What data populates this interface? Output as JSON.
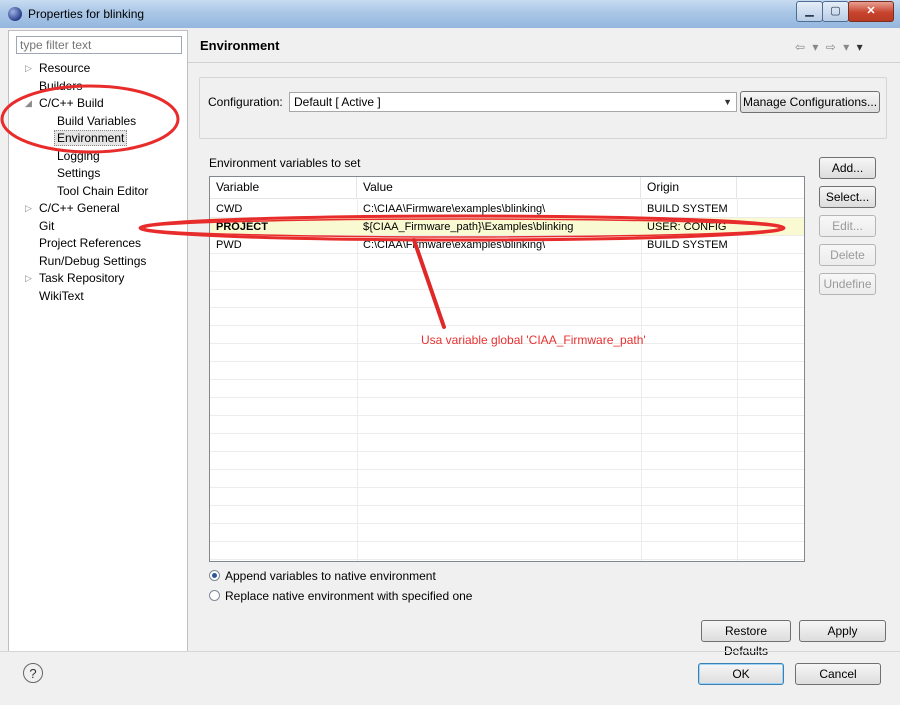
{
  "window": {
    "title": "Properties for blinking",
    "controls": {
      "minimize": "▁",
      "maximize": "▢",
      "close": "✕"
    }
  },
  "sidebar": {
    "filter_placeholder": "type filter text",
    "items": [
      {
        "label": "Resource",
        "level": 0,
        "arrow": "▷"
      },
      {
        "label": "Builders",
        "level": 0,
        "arrow": ""
      },
      {
        "label": "C/C++ Build",
        "level": 0,
        "arrow": "◢"
      },
      {
        "label": "Build Variables",
        "level": 1,
        "arrow": ""
      },
      {
        "label": "Environment",
        "level": 1,
        "arrow": ""
      },
      {
        "label": "Logging",
        "level": 1,
        "arrow": ""
      },
      {
        "label": "Settings",
        "level": 1,
        "arrow": ""
      },
      {
        "label": "Tool Chain Editor",
        "level": 1,
        "arrow": ""
      },
      {
        "label": "C/C++ General",
        "level": 0,
        "arrow": "▷"
      },
      {
        "label": "Git",
        "level": 0,
        "arrow": ""
      },
      {
        "label": "Project References",
        "level": 0,
        "arrow": ""
      },
      {
        "label": "Run/Debug Settings",
        "level": 0,
        "arrow": ""
      },
      {
        "label": "Task Repository",
        "level": 0,
        "arrow": "▷"
      },
      {
        "label": "WikiText",
        "level": 0,
        "arrow": ""
      }
    ]
  },
  "header": {
    "title": "Environment",
    "nav": {
      "back": "⇦",
      "forward": "⇨",
      "dropdown": "▾",
      "menu": "▾"
    }
  },
  "configuration": {
    "label": "Configuration:",
    "value": "Default  [ Active ]",
    "manage_button": "Manage Configurations..."
  },
  "env_table": {
    "label": "Environment variables to set",
    "columns": [
      "Variable",
      "Value",
      "Origin"
    ],
    "rows": [
      {
        "variable": "CWD",
        "value": "C:\\CIAA\\Firmware\\examples\\blinking\\",
        "origin": "BUILD SYSTEM"
      },
      {
        "variable": "PROJECT",
        "value": "${CIAA_Firmware_path}\\Examples\\blinking",
        "origin": "USER: CONFIG"
      },
      {
        "variable": "PWD",
        "value": "C:\\CIAA\\Firmware\\examples\\blinking\\",
        "origin": "BUILD SYSTEM"
      }
    ]
  },
  "side_buttons": {
    "add": "Add...",
    "select": "Select...",
    "edit": "Edit...",
    "delete": "Delete",
    "undefine": "Undefine"
  },
  "radios": {
    "append": "Append variables to native environment",
    "replace": "Replace native environment with specified one",
    "selected": "append"
  },
  "footer": {
    "restore": "Restore Defaults",
    "apply": "Apply",
    "ok": "OK",
    "cancel": "Cancel",
    "help": "?"
  },
  "annotation": {
    "text": "Usa variable global 'CIAA_Firmware_path'",
    "color": "#e83030"
  }
}
